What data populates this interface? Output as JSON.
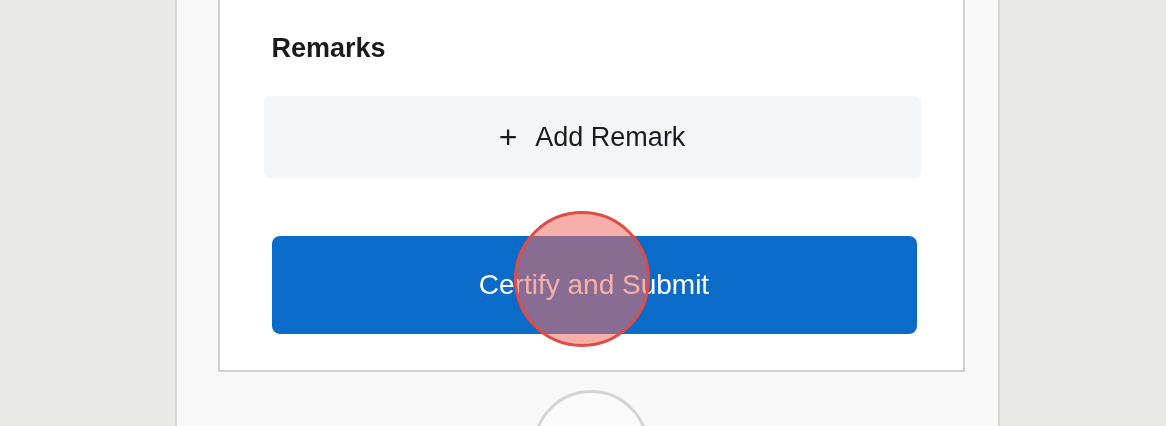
{
  "remarks_section": {
    "title": "Remarks"
  },
  "add_remark_button": {
    "icon": "+",
    "label": "Add Remark"
  },
  "submit_button": {
    "label": "Certify and Submit"
  }
}
